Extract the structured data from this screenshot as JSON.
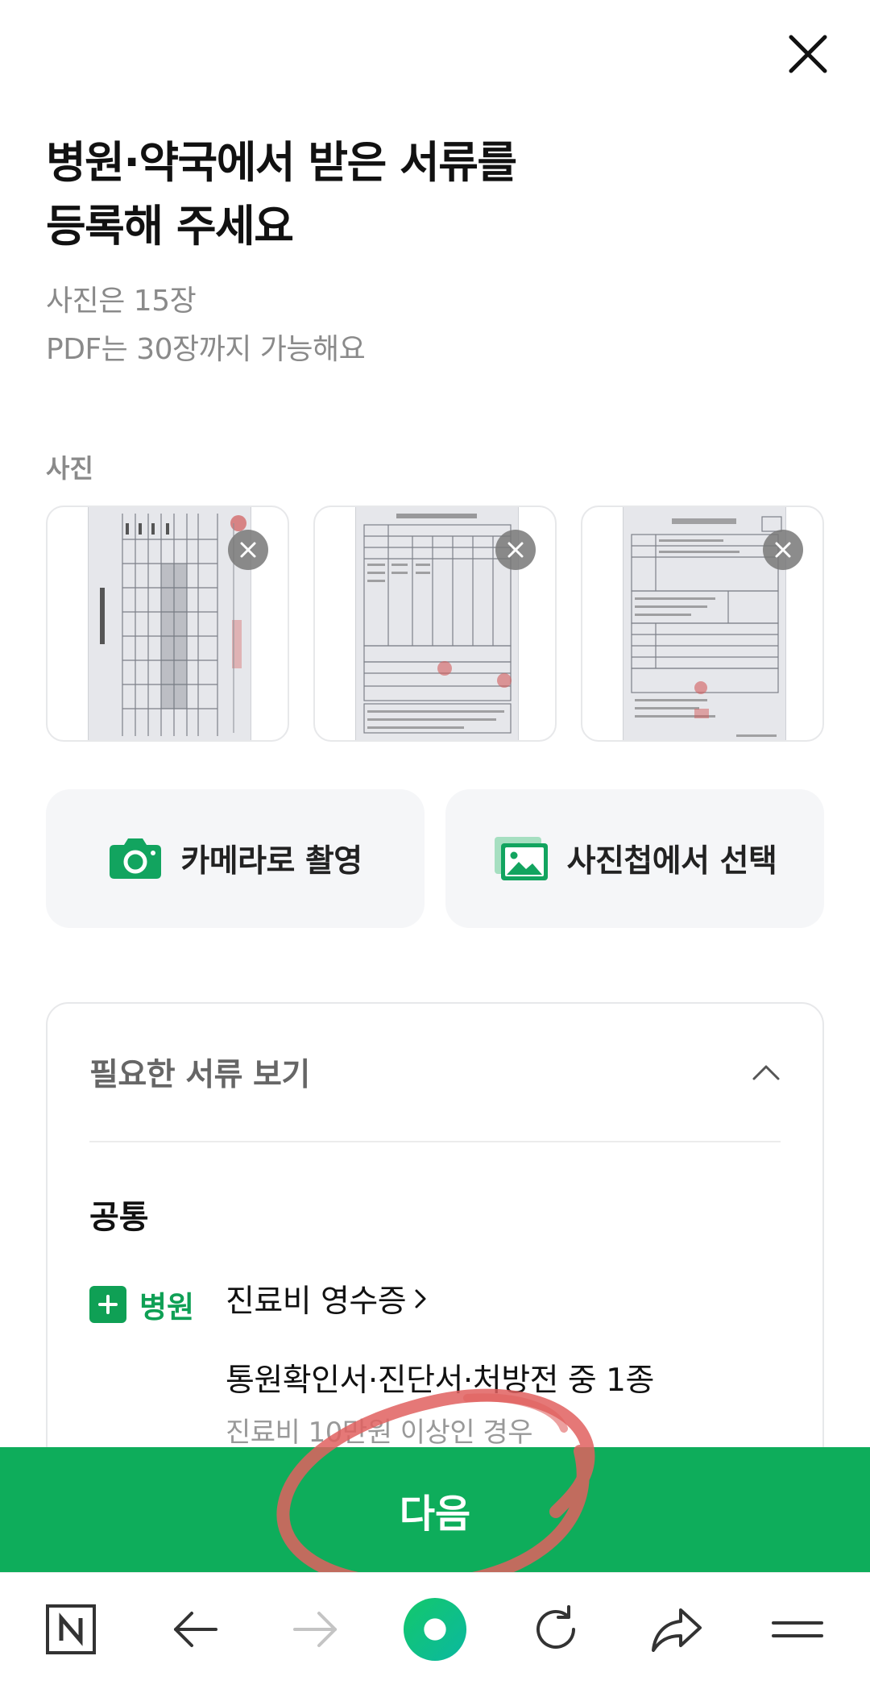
{
  "header": {
    "title_line1": "병원·약국에서 받은 서류를",
    "title_line2": "등록해 주세요",
    "subtitle_line1": "사진은 15장",
    "subtitle_line2": "PDF는 30장까지 가능해요"
  },
  "photos": {
    "section_label": "사진",
    "count": 3
  },
  "actions": {
    "camera_label": "카메라로 촬영",
    "gallery_label": "사진첩에서 선택"
  },
  "required_docs": {
    "header_label": "필요한 서류 보기",
    "group_title": "공통",
    "tag_label": "병원",
    "item1": "진료비 영수증",
    "item2": "통원확인서·진단서·처방전 중 1종",
    "item2_note": "진료비 10만원 이상인 경우"
  },
  "footer": {
    "next_label": "다음"
  },
  "colors": {
    "brand_green": "#0ead5b",
    "annotation_red": "#e0605f"
  },
  "icons": {
    "close": "close-icon",
    "camera": "camera-icon",
    "gallery": "gallery-icon",
    "chevron_up": "chevron-up-icon",
    "home": "naver-home-icon",
    "back": "back-arrow-icon",
    "forward": "forward-arrow-icon",
    "green_dot": "green-dot-icon",
    "reload": "reload-icon",
    "share": "share-icon",
    "menu": "menu-icon"
  }
}
